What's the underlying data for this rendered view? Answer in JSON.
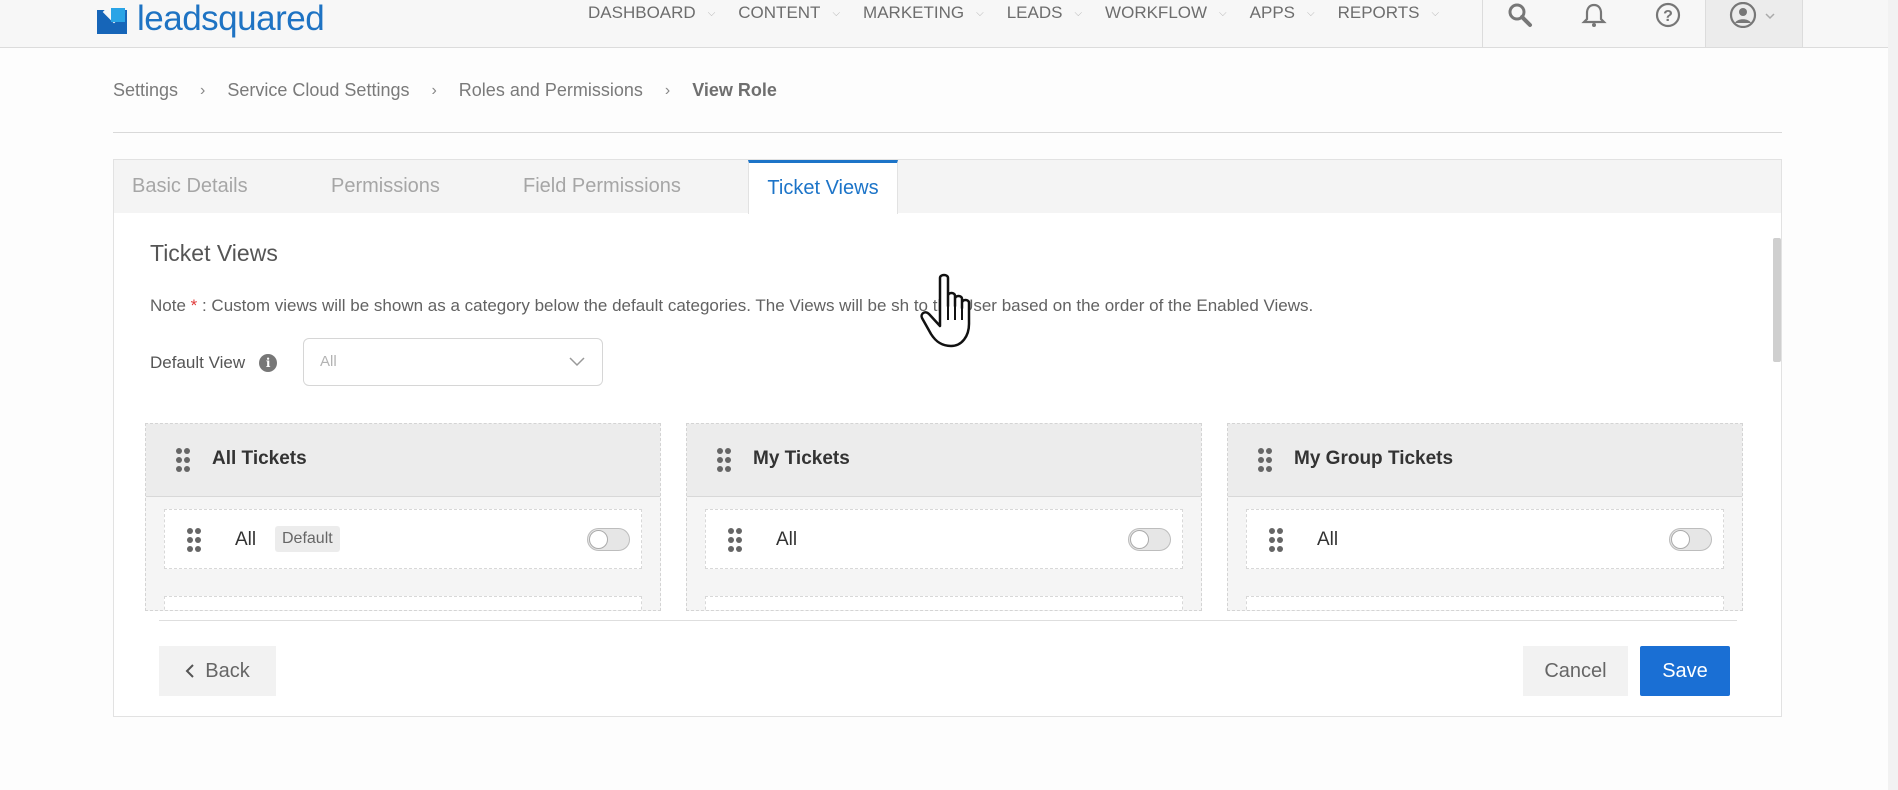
{
  "app": {
    "logo_text": "leadsquared"
  },
  "nav": {
    "items": [
      {
        "label": "DASHBOARD"
      },
      {
        "label": "CONTENT"
      },
      {
        "label": "MARKETING"
      },
      {
        "label": "LEADS"
      },
      {
        "label": "WORKFLOW"
      },
      {
        "label": "APPS"
      },
      {
        "label": "REPORTS"
      }
    ],
    "icons": [
      "search-icon",
      "bell-icon",
      "help-icon",
      "user-icon"
    ]
  },
  "breadcrumb": [
    {
      "label": "Settings"
    },
    {
      "label": "Service Cloud Settings"
    },
    {
      "label": "Roles and Permissions"
    },
    {
      "label": "View Role"
    }
  ],
  "tabs": [
    {
      "label": "Basic Details",
      "active": false
    },
    {
      "label": "Permissions",
      "active": false
    },
    {
      "label": "Field Permissions",
      "active": false
    },
    {
      "label": "Ticket Views",
      "active": true
    }
  ],
  "content": {
    "title": "Ticket Views",
    "note_prefix": "Note ",
    "note_star": "*",
    "note_text": " : Custom views will be shown as a category below the default categories. The Views will be sh  to the User based on the order of the Enabled Views.",
    "default_view_label": "Default View",
    "default_view_value": "All"
  },
  "columns": [
    {
      "title": "All Tickets",
      "item": {
        "label": "All",
        "badge": "Default",
        "enabled": false
      }
    },
    {
      "title": "My Tickets",
      "item": {
        "label": "All",
        "badge": "",
        "enabled": false
      }
    },
    {
      "title": "My Group Tickets",
      "item": {
        "label": "All",
        "badge": "",
        "enabled": false
      }
    }
  ],
  "footer": {
    "back_label": "Back",
    "cancel_label": "Cancel",
    "save_label": "Save"
  },
  "colors": {
    "accent": "#1a6fd4",
    "tab_active": "#1c74c8",
    "logo": "#1e73c3"
  }
}
